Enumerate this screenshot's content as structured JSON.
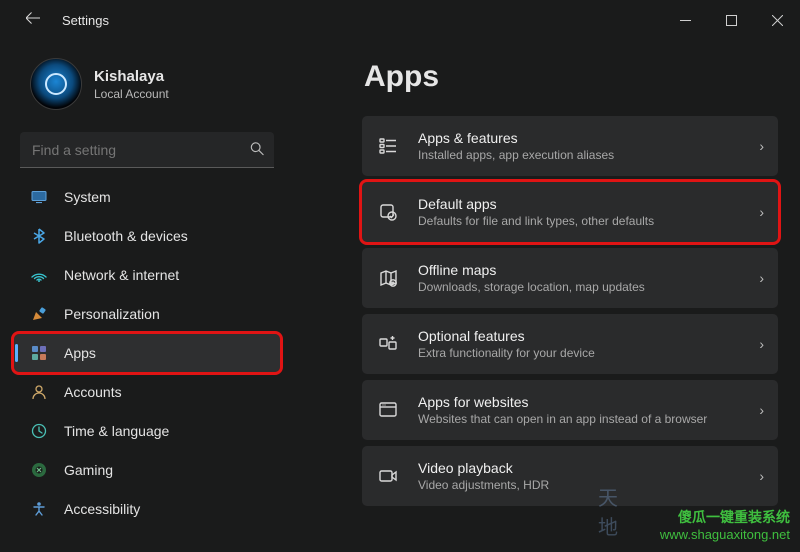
{
  "window": {
    "title": "Settings",
    "minimize_label": "Minimize",
    "maximize_label": "Maximize",
    "close_label": "Close"
  },
  "profile": {
    "name": "Kishalaya",
    "sub": "Local Account"
  },
  "search": {
    "placeholder": "Find a setting"
  },
  "nav": {
    "items": [
      {
        "label": "System",
        "icon": "system"
      },
      {
        "label": "Bluetooth & devices",
        "icon": "bluetooth"
      },
      {
        "label": "Network & internet",
        "icon": "network"
      },
      {
        "label": "Personalization",
        "icon": "personalization"
      },
      {
        "label": "Apps",
        "icon": "apps",
        "active": true,
        "highlighted": true
      },
      {
        "label": "Accounts",
        "icon": "accounts"
      },
      {
        "label": "Time & language",
        "icon": "time"
      },
      {
        "label": "Gaming",
        "icon": "gaming"
      },
      {
        "label": "Accessibility",
        "icon": "accessibility"
      }
    ]
  },
  "page": {
    "title": "Apps"
  },
  "cards": [
    {
      "title": "Apps & features",
      "sub": "Installed apps, app execution aliases",
      "icon": "apps-features"
    },
    {
      "title": "Default apps",
      "sub": "Defaults for file and link types, other defaults",
      "icon": "default-apps",
      "highlighted": true
    },
    {
      "title": "Offline maps",
      "sub": "Downloads, storage location, map updates",
      "icon": "maps"
    },
    {
      "title": "Optional features",
      "sub": "Extra functionality for your device",
      "icon": "optional"
    },
    {
      "title": "Apps for websites",
      "sub": "Websites that can open in an app instead of a browser",
      "icon": "websites"
    },
    {
      "title": "Video playback",
      "sub": "Video adjustments, HDR",
      "icon": "video"
    }
  ],
  "watermark": {
    "line1": "傻瓜一键重装系统",
    "line2": "www.shaguaxitong.net",
    "badge": "天地"
  }
}
